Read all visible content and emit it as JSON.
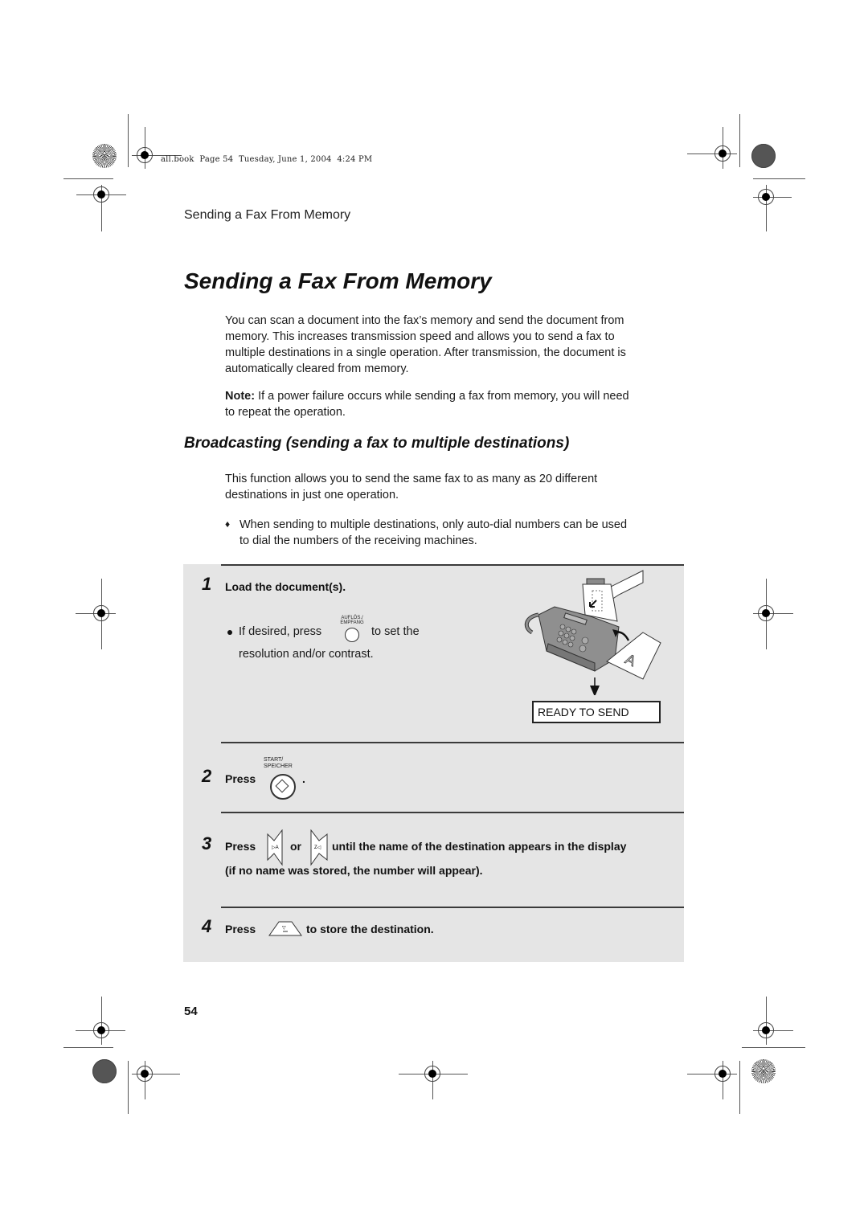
{
  "print_meta": "all.book  Page 54  Tuesday, June 1, 2004  4:24 PM",
  "running_head": "Sending a Fax From Memory",
  "title": "Sending a Fax From Memory",
  "intro": [
    "You can scan a document into the fax’s memory and send the document from",
    "memory. This increases transmission speed and allows you to send a fax to",
    "multiple destinations in a single operation. After transmission, the document is",
    "automatically cleared from memory."
  ],
  "note": {
    "label": "Note:",
    "lines": [
      " If a power failure occurs while sending a fax from memory, you will need",
      "to repeat the operation."
    ]
  },
  "section_heading": "Broadcasting (sending a fax to multiple destinations)",
  "section_para": [
    "This function allows you to send the same fax to as many as 20 different",
    "destinations in just one operation."
  ],
  "section_bullet": {
    "icon": "diamond",
    "lines": [
      "When sending to multiple destinations, only auto-dial numbers can be used",
      "to dial the numbers of the receiving machines."
    ]
  },
  "steps": [
    {
      "number": "1",
      "title": "Load the document(s).",
      "sub_bullet_pre": "If desired, press",
      "button_label": "AUFLÖS./\nEMPFANG",
      "sub_bullet_post": "to set the",
      "sub_bullet_line2": "resolution and/or contrast.",
      "display": "READY TO SEND"
    },
    {
      "number": "2",
      "pre": "Press",
      "button_label": "START/\nSPEICHER",
      "post": "."
    },
    {
      "number": "3",
      "pre": "Press",
      "mid": "or",
      "post": "until the name of the destination appears in the display",
      "line2": "(if no name was stored, the number will appear)."
    },
    {
      "number": "4",
      "pre": "Press",
      "post": "to store the destination."
    }
  ],
  "page_number": "54"
}
